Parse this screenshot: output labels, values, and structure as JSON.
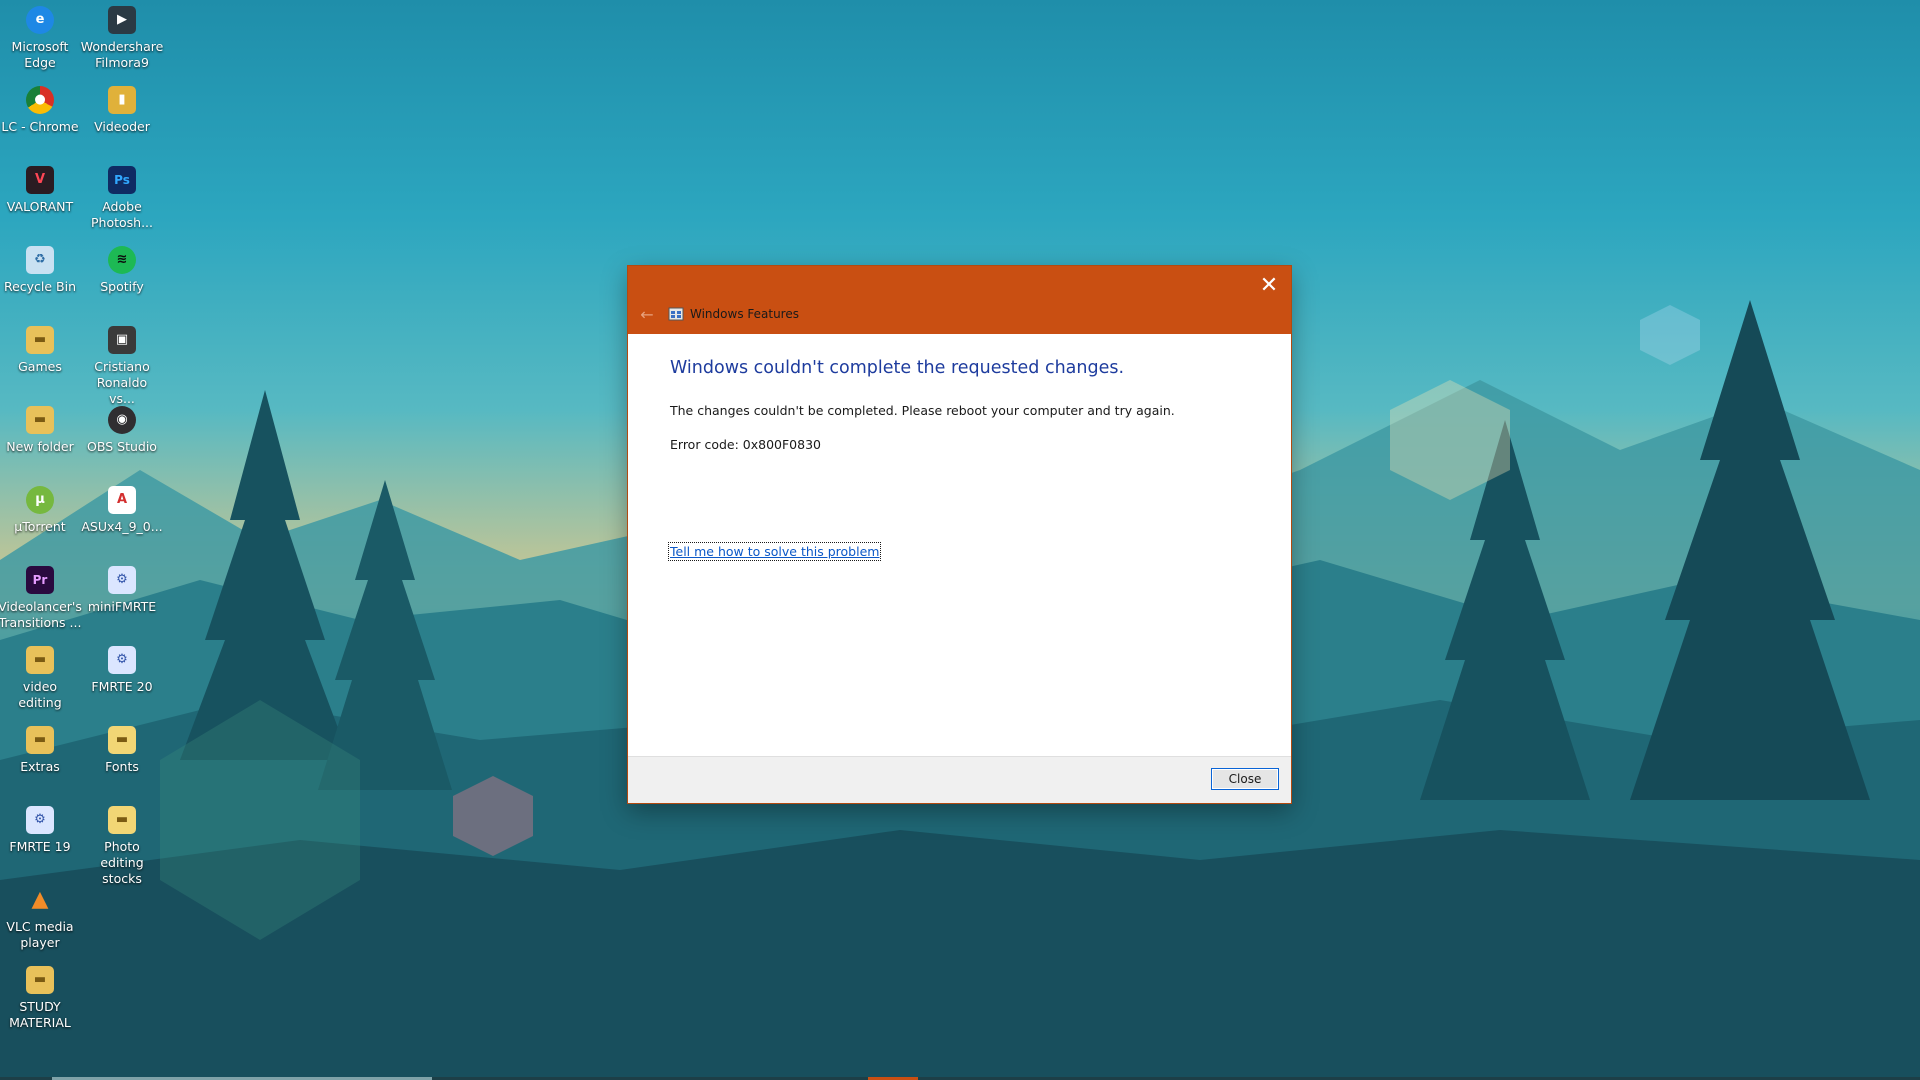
{
  "desktop": {
    "icons": [
      {
        "label": "Microsoft Edge",
        "icon": "edge-icon",
        "color": "#1e88e5"
      },
      {
        "label": "Wondershare Filmora9",
        "icon": "filmora-icon",
        "color": "#2b3a44"
      },
      {
        "label": "LC - Chrome",
        "icon": "chrome-icon",
        "color": "#d93025"
      },
      {
        "label": "Videoder",
        "icon": "videoder-icon",
        "color": "#e0b13a"
      },
      {
        "label": "VALORANT",
        "icon": "valorant-icon",
        "color": "#ff4655"
      },
      {
        "label": "Adobe Photosh...",
        "icon": "photoshop-icon",
        "color": "#0f2b63"
      },
      {
        "label": "Recycle Bin",
        "icon": "recycle-bin-icon",
        "color": "#9ec7e6"
      },
      {
        "label": "Spotify",
        "icon": "spotify-icon",
        "color": "#1db954"
      },
      {
        "label": "Games",
        "icon": "folder-icon",
        "color": "#e8c15a"
      },
      {
        "label": "Cristiano Ronaldo vs...",
        "icon": "video-thumbnail-icon",
        "color": "#3a3a3a"
      },
      {
        "label": "New folder",
        "icon": "folder-icon",
        "color": "#e8c15a"
      },
      {
        "label": "OBS Studio",
        "icon": "obs-icon",
        "color": "#302e31"
      },
      {
        "label": "µTorrent",
        "icon": "utorrent-icon",
        "color": "#76b83f"
      },
      {
        "label": "ASUx4_9_0...",
        "icon": "pdf-icon",
        "color": "#d32f2f"
      },
      {
        "label": "Videolancer's Transitions ...",
        "icon": "premiere-icon",
        "color": "#2a0a3f"
      },
      {
        "label": "miniFMRTE",
        "icon": "fmrte-icon",
        "color": "#5a7fd6"
      },
      {
        "label": "video editing",
        "icon": "folder-icon",
        "color": "#e8c15a"
      },
      {
        "label": "FMRTE 20",
        "icon": "fmrte-icon",
        "color": "#5a7fd6"
      },
      {
        "label": "Extras",
        "icon": "folder-icon",
        "color": "#e8c15a"
      },
      {
        "label": "Fonts",
        "icon": "folder-icon",
        "color": "#f2d675"
      },
      {
        "label": "FMRTE 19",
        "icon": "fmrte-icon",
        "color": "#5a7fd6"
      },
      {
        "label": "Photo editing stocks",
        "icon": "folder-icon",
        "color": "#f2d675"
      },
      {
        "label": "VLC media player",
        "icon": "vlc-icon",
        "color": "#f28c28"
      },
      {
        "label": "STUDY MATERIAL",
        "icon": "folder-icon",
        "color": "#e8c15a"
      }
    ]
  },
  "dialog": {
    "title": "Windows Features",
    "heading": "Windows couldn't complete the requested changes.",
    "message": "The changes couldn't be completed. Please reboot your computer and try again.",
    "error_code": "Error code: 0x800F0830",
    "help_link": "Tell me how to solve this problem",
    "close_button": "Close",
    "accent_color": "#c94f12"
  }
}
